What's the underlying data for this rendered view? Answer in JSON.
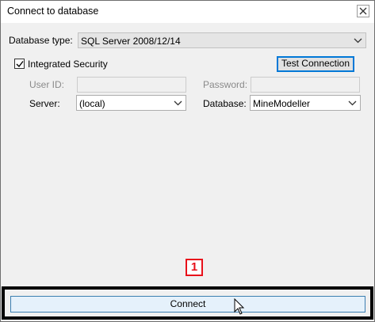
{
  "window": {
    "title": "Connect to database"
  },
  "form": {
    "database_type_label": "Database type:",
    "database_type_value": "SQL Server 2008/12/14",
    "integrated_security_label": "Integrated Security",
    "integrated_security_checked": true,
    "test_connection_label": "Test Connection",
    "user_id_label": "User ID:",
    "user_id_value": "",
    "password_label": "Password:",
    "password_value": "",
    "server_label": "Server:",
    "server_value": "(local)",
    "database_label": "Database:",
    "database_value": "MineModeller"
  },
  "annotation": {
    "number": "1",
    "color": "#e8101a"
  },
  "footer": {
    "connect_label": "Connect"
  }
}
